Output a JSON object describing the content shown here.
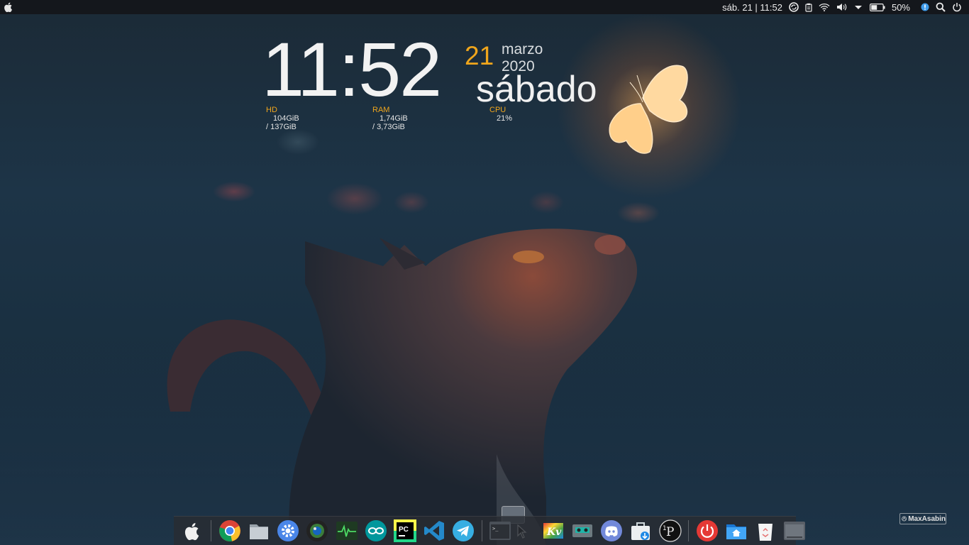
{
  "topbar": {
    "datetime": "sáb. 21 | 11:52",
    "battery_percent": "50%",
    "battery_level": 0.5,
    "icons": [
      "apple-icon",
      "sync-icon",
      "clipboard-icon",
      "wifi-icon",
      "volume-icon",
      "dropdown-icon",
      "battery-icon",
      "notification-icon",
      "search-icon",
      "power-icon"
    ]
  },
  "conky": {
    "time": "11:52",
    "day": "21",
    "month_year": "marzo 2020",
    "weekday": "sábado",
    "hd_label": "HD",
    "hd_value": "104GiB / 137GiB",
    "ram_label": "RAM",
    "ram_value": "1,74GiB / 3,73GiB",
    "cpu_label": "CPU",
    "cpu_value": "21%",
    "accent": "#f0a61c"
  },
  "dock": {
    "items": [
      "finder",
      "chrome",
      "files",
      "settings",
      "shutter",
      "system-monitor",
      "arduino",
      "pycharm",
      "vscode",
      "telegram",
      "terminal",
      "kivy",
      "cassette",
      "discord",
      "store",
      "pycharm-edu",
      "logout",
      "home-folder",
      "trash",
      "minimized-window"
    ]
  },
  "watermark": "MaxAsabin"
}
